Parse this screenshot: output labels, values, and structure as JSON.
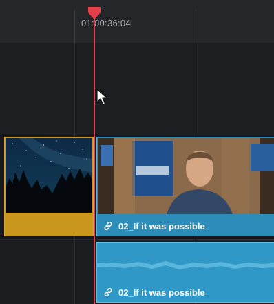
{
  "ruler": {
    "timecode": "01:00:36:04"
  },
  "video_clip_left": {
    "icon": "starry-night-thumbnail"
  },
  "video_clip_right": {
    "label": "02_If it was possible",
    "icon": "link-icon",
    "color": "#2e8db8"
  },
  "audio_clip": {
    "label": "02_If it was possible",
    "icon": "link-icon",
    "color": "#2f98c6"
  },
  "playhead": {
    "color": "#e4404a"
  },
  "colors": {
    "left_clip": "#c9961e",
    "background": "#1f2024"
  }
}
